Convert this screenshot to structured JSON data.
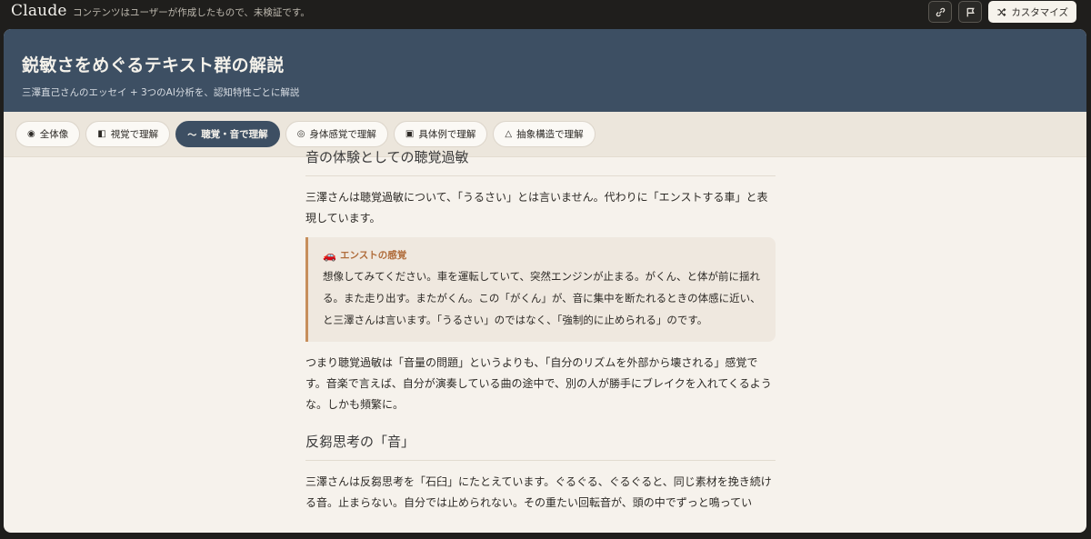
{
  "header": {
    "brand": "Claude",
    "notice": "コンテンツはユーザーが作成したもので、未検証です。",
    "customize_label": "カスタマイズ"
  },
  "hero": {
    "title": "鋭敏さをめぐるテキスト群の解説",
    "subtitle": "三澤直己さんのエッセイ + 3つのAI分析を、認知特性ごとに解説"
  },
  "tabs": [
    {
      "glyph": "◉",
      "label": "全体像"
    },
    {
      "glyph": "◧",
      "label": "視覚で理解"
    },
    {
      "glyph": "〜",
      "label": "聴覚・音で理解"
    },
    {
      "glyph": "◎",
      "label": "身体感覚で理解"
    },
    {
      "glyph": "▣",
      "label": "具体例で理解"
    },
    {
      "glyph": "△",
      "label": "抽象構造で理解"
    }
  ],
  "active_tab": "聴覚・音で理解",
  "article": {
    "section1_title": "音の体験としての聴覚過敏",
    "section1_p1": "三澤さんは聴覚過敏について、「うるさい」とは言いません。代わりに「エンストする車」と表現しています。",
    "callout_title": "エンストの感覚",
    "callout_body": "想像してみてください。車を運転していて、突然エンジンが止まる。がくん、と体が前に揺れる。また走り出す。またがくん。この「がくん」が、音に集中を断たれるときの体感に近い、と三澤さんは言います。「うるさい」のではなく、「強制的に止められる」のです。",
    "section1_p2": "つまり聴覚過敏は「音量の問題」というよりも、「自分のリズムを外部から壊される」感覚です。音楽で言えば、自分が演奏している曲の途中で、別の人が勝手にブレイクを入れてくるような。しかも頻繁に。",
    "section2_title": "反芻思考の「音」",
    "section2_p1": "三澤さんは反芻思考を「石臼」にたとえています。ぐるぐる、ぐるぐると、同じ素材を挽き続ける音。止まらない。自分では止められない。その重たい回転音が、頭の中でずっと鳴ってい"
  }
}
